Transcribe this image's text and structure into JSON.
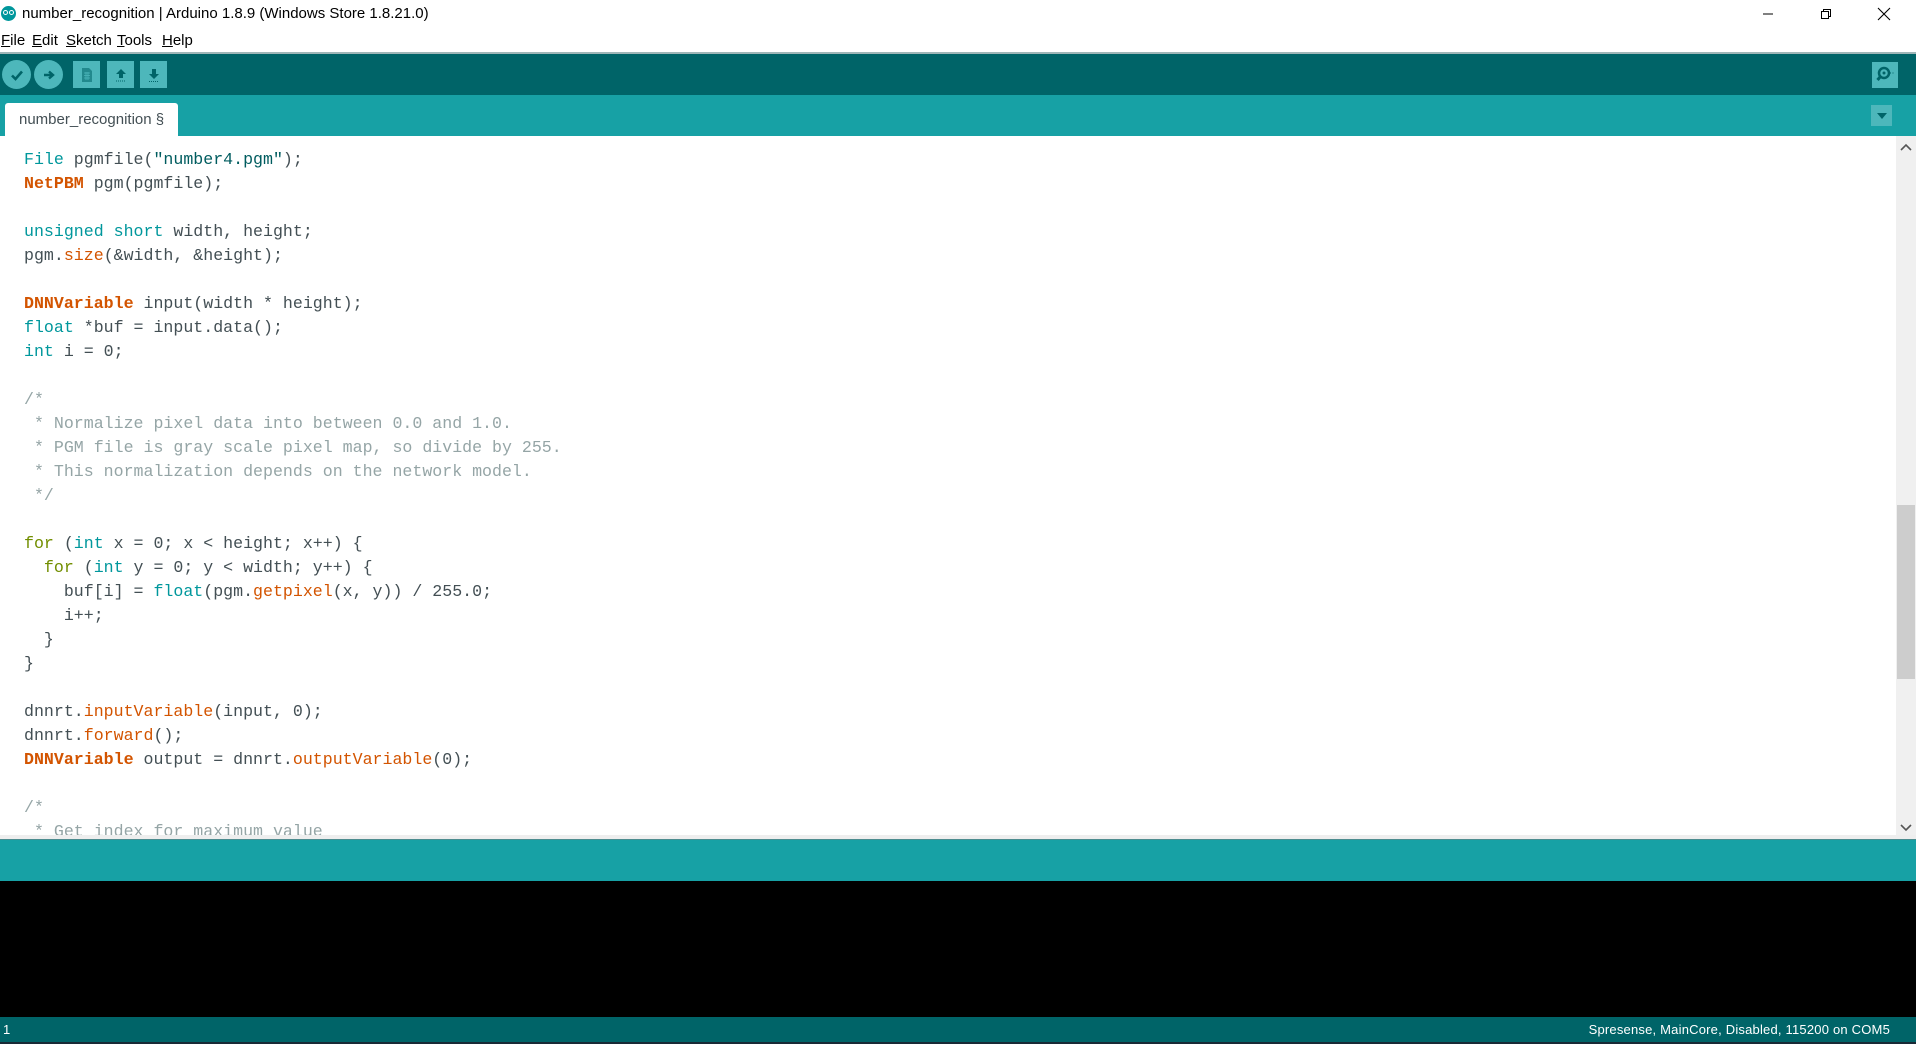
{
  "window": {
    "title": "number_recognition | Arduino 1.8.9 (Windows Store 1.8.21.0)",
    "controls": {
      "minimize": "minimize-icon",
      "maximize": "restore-icon",
      "close": "close-icon"
    }
  },
  "menu": [
    {
      "mnemonic": "F",
      "rest": "ile"
    },
    {
      "mnemonic": "E",
      "rest": "dit"
    },
    {
      "mnemonic": "S",
      "rest": "ketch"
    },
    {
      "mnemonic": "T",
      "rest": "ools"
    },
    {
      "mnemonic": "H",
      "rest": "elp"
    }
  ],
  "toolbar": {
    "buttons": [
      "verify",
      "upload",
      "new",
      "open",
      "save"
    ],
    "right_button": "serial-monitor"
  },
  "tabs": [
    {
      "label": "number_recognition §",
      "active": true
    }
  ],
  "editor": {
    "lines": [
      [
        [
          "kw",
          "File"
        ],
        [
          "p",
          " pgmfile("
        ],
        [
          "str",
          "\"number4.pgm\""
        ],
        [
          "p",
          ");"
        ]
      ],
      [
        [
          "type",
          "NetPBM"
        ],
        [
          "p",
          " pgm(pgmfile);"
        ]
      ],
      [],
      [
        [
          "kw",
          "unsigned"
        ],
        [
          "p",
          " "
        ],
        [
          "kw",
          "short"
        ],
        [
          "p",
          " width, height;"
        ]
      ],
      [
        [
          "p",
          "pgm."
        ],
        [
          "fn",
          "size"
        ],
        [
          "p",
          "(&width, &height);"
        ]
      ],
      [],
      [
        [
          "type",
          "DNNVariable"
        ],
        [
          "p",
          " input(width * height);"
        ]
      ],
      [
        [
          "kw",
          "float"
        ],
        [
          "p",
          " *buf = input.data();"
        ]
      ],
      [
        [
          "kw",
          "int"
        ],
        [
          "p",
          " i = 0;"
        ]
      ],
      [],
      [
        [
          "cm",
          "/*"
        ]
      ],
      [
        [
          "cm",
          " * Normalize pixel data into between 0.0 and 1.0."
        ]
      ],
      [
        [
          "cm",
          " * PGM file is gray scale pixel map, so divide by 255."
        ]
      ],
      [
        [
          "cm",
          " * This normalization depends on the network model."
        ]
      ],
      [
        [
          "cm",
          " */"
        ]
      ],
      [],
      [
        [
          "ctl",
          "for"
        ],
        [
          "p",
          " ("
        ],
        [
          "kw",
          "int"
        ],
        [
          "p",
          " x = 0; x < height; x++) {"
        ]
      ],
      [
        [
          "p",
          "  "
        ],
        [
          "ctl",
          "for"
        ],
        [
          "p",
          " ("
        ],
        [
          "kw",
          "int"
        ],
        [
          "p",
          " y = 0; y < width; y++) {"
        ]
      ],
      [
        [
          "p",
          "    buf[i] = "
        ],
        [
          "kw",
          "float"
        ],
        [
          "p",
          "(pgm."
        ],
        [
          "fn",
          "getpixel"
        ],
        [
          "p",
          "(x, y)) / 255.0;"
        ]
      ],
      [
        [
          "p",
          "    i++;"
        ]
      ],
      [
        [
          "p",
          "  }"
        ]
      ],
      [
        [
          "p",
          "}"
        ]
      ],
      [],
      [
        [
          "p",
          "dnnrt."
        ],
        [
          "fn",
          "inputVariable"
        ],
        [
          "p",
          "(input, 0);"
        ]
      ],
      [
        [
          "p",
          "dnnrt."
        ],
        [
          "fn",
          "forward"
        ],
        [
          "p",
          "();"
        ]
      ],
      [
        [
          "type",
          "DNNVariable"
        ],
        [
          "p",
          " output = dnnrt."
        ],
        [
          "fn",
          "outputVariable"
        ],
        [
          "p",
          "(0);"
        ]
      ],
      [],
      [
        [
          "cm",
          "/*"
        ]
      ],
      [
        [
          "cm",
          " * Get index for maximum value"
        ]
      ]
    ],
    "scroll_position_fraction": 0.42
  },
  "message_area": "",
  "console_output": "",
  "status": {
    "line_number": "1",
    "board_info": "Spresense, MainCore, Disabled, 115200 on COM5"
  },
  "colors": {
    "toolbar": "#006468",
    "tabbar": "#17A1A5",
    "button": "#4DB7BB",
    "keyword": "#00979C",
    "type": "#D35400",
    "control": "#728E00",
    "comment": "#95A5A6"
  }
}
